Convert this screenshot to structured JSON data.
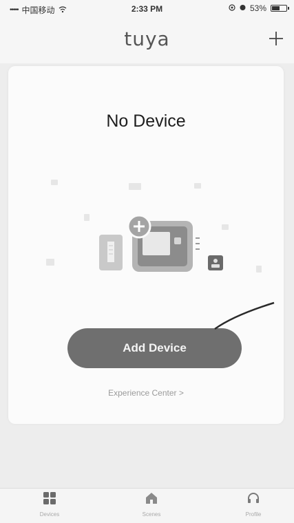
{
  "status_bar": {
    "signal": "•••••",
    "carrier": "中国移动",
    "time": "2:33 PM",
    "battery": "53%",
    "battery_level": 0.53
  },
  "header": {
    "logo": "tuya",
    "add_icon": "plus-icon"
  },
  "main": {
    "title": "No Device",
    "add_device_label": "Add Device",
    "experience_label": "Experience Center >"
  },
  "tabs": [
    {
      "label": "Devices",
      "icon": "grid-icon"
    },
    {
      "label": "Scenes",
      "icon": "home-icon"
    },
    {
      "label": "Profile",
      "icon": "headset-icon"
    }
  ],
  "colors": {
    "button": "#6f6f6f",
    "background": "#ededed",
    "card": "#fbfbfb"
  }
}
